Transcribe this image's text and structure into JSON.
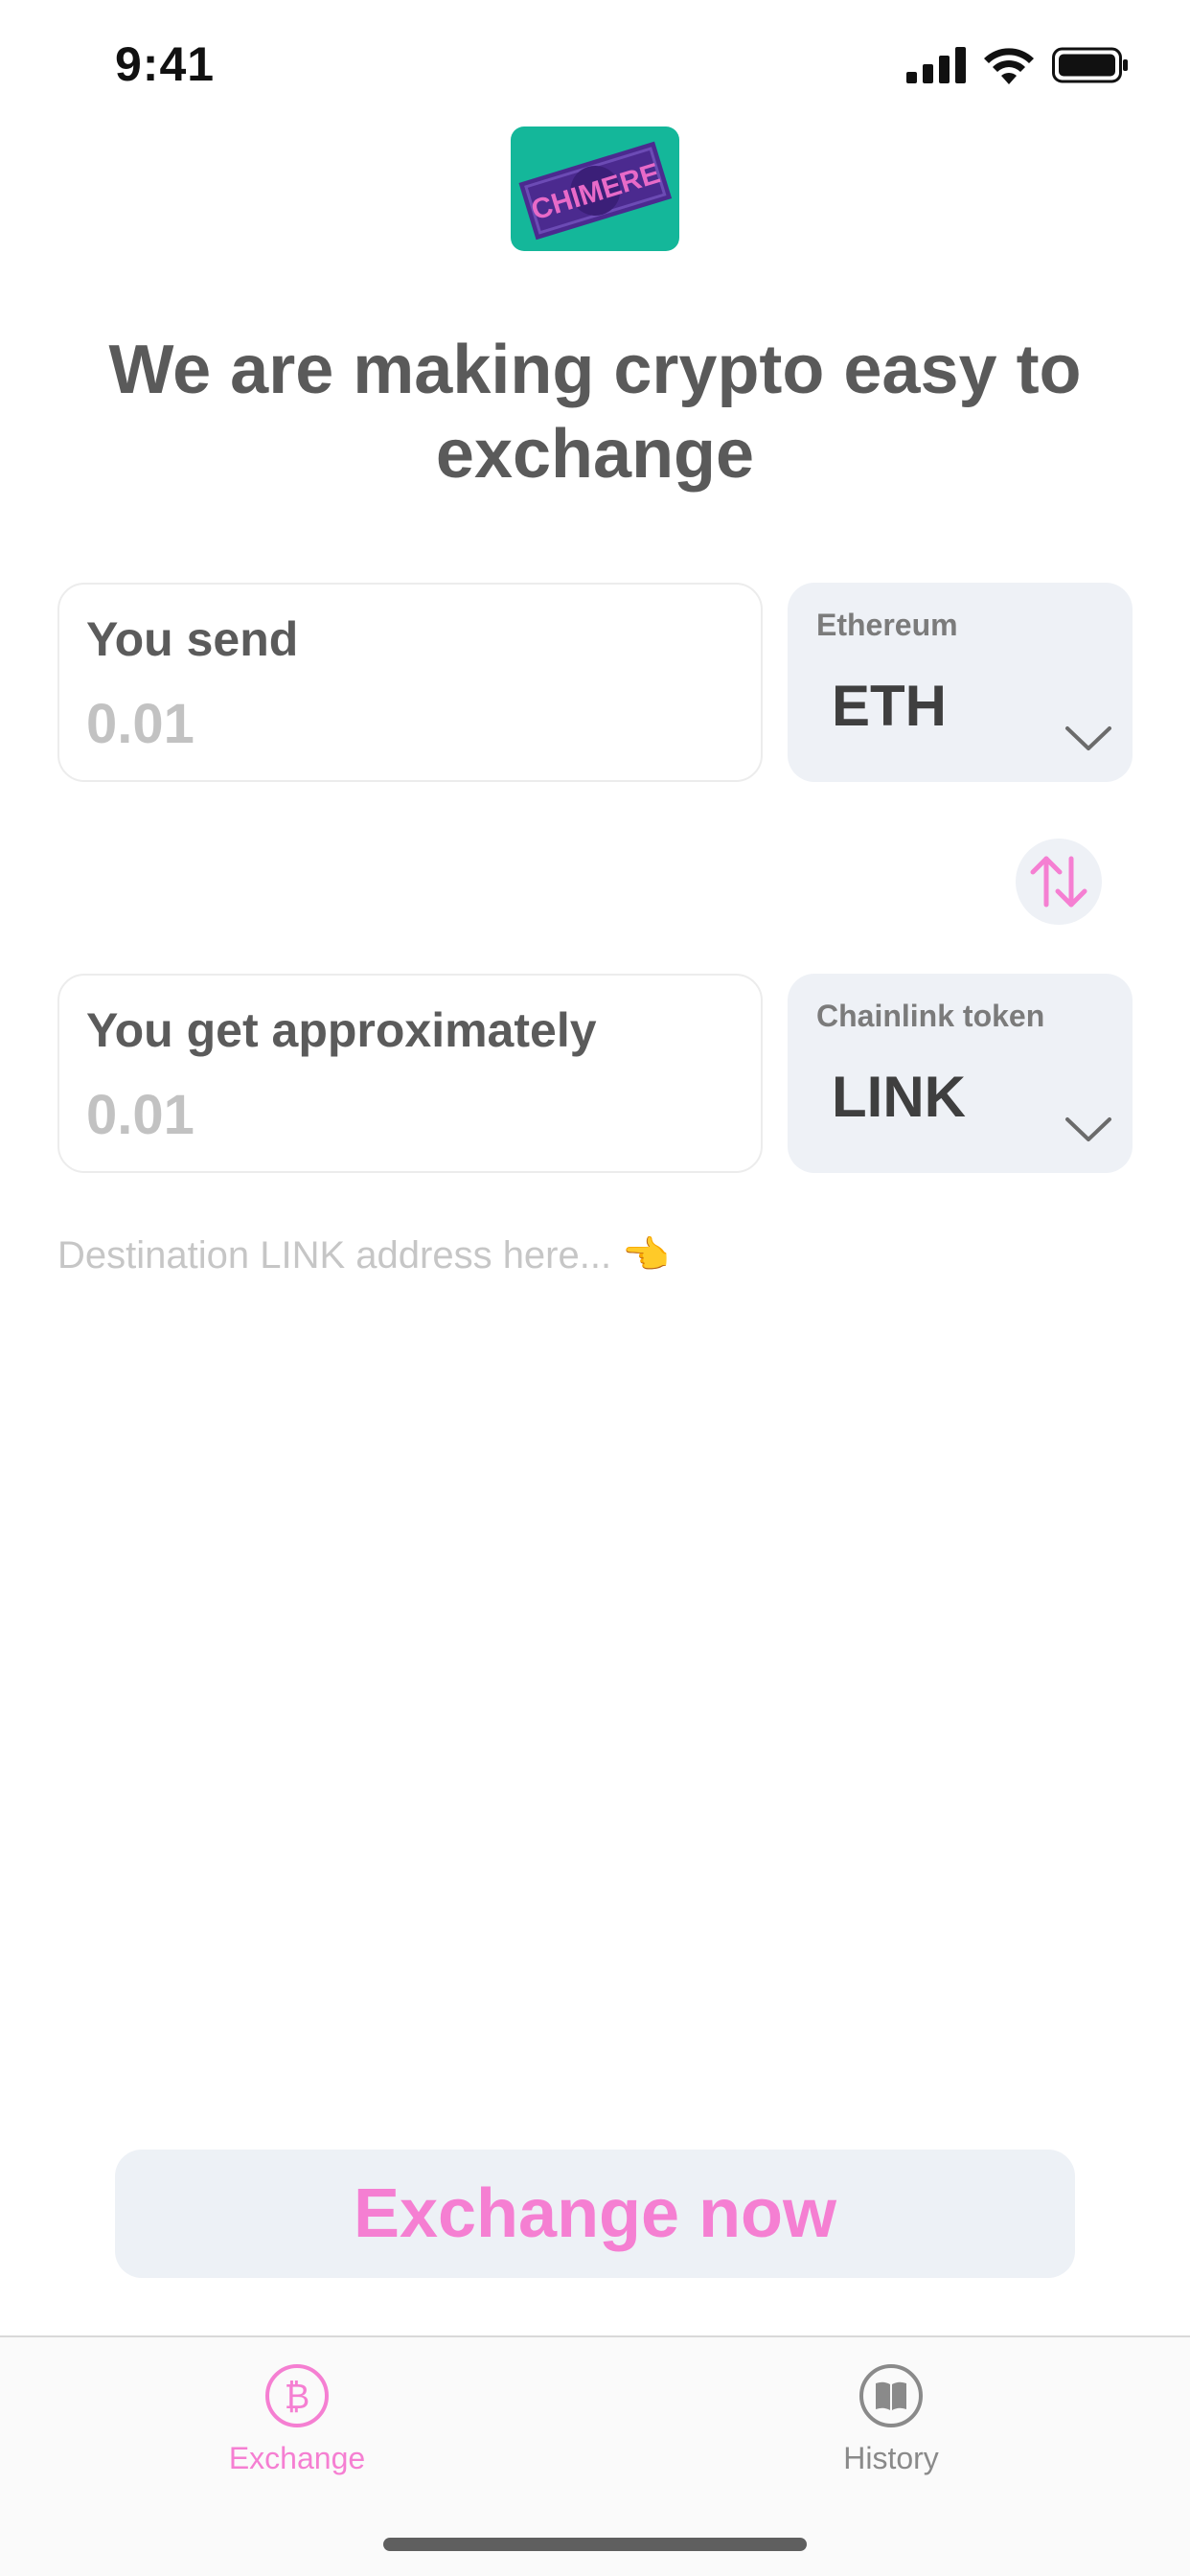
{
  "status_bar": {
    "time": "9:41"
  },
  "logo": {
    "text": "CHIMERE"
  },
  "headline": "We are making crypto easy to exchange",
  "send": {
    "label": "You send",
    "placeholder": "0.01",
    "currency_name": "Ethereum",
    "currency_ticker": "ETH"
  },
  "receive": {
    "label": "You get approximately",
    "placeholder": "0.01",
    "currency_name": "Chainlink token",
    "currency_ticker": "LINK"
  },
  "address": {
    "placeholder": "Destination LINK address here... 👈"
  },
  "exchange_button": "Exchange now",
  "tabs": [
    {
      "label": "Exchange",
      "icon": "bitcoin-icon",
      "active": true
    },
    {
      "label": "History",
      "icon": "book-icon",
      "active": false
    }
  ],
  "colors": {
    "accent": "#f57fd2",
    "logo_bg": "#14b79a",
    "card_bg": "#eef1f6",
    "text_dark": "#5a5a5a"
  }
}
